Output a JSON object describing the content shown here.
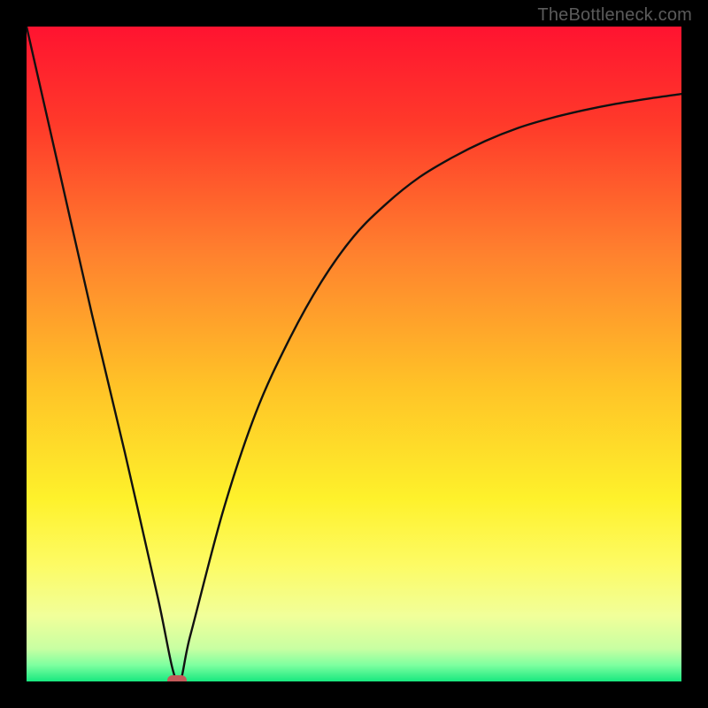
{
  "watermark": "TheBottleneck.com",
  "chart_data": {
    "type": "line",
    "title": "",
    "xlabel": "",
    "ylabel": "",
    "xlim": [
      0,
      100
    ],
    "ylim": [
      0,
      100
    ],
    "grid": false,
    "legend": false,
    "series": [
      {
        "name": "bottleneck-curve",
        "x": [
          0,
          5,
          10,
          15,
          20,
          23,
          25,
          30,
          35,
          40,
          45,
          50,
          55,
          60,
          65,
          70,
          75,
          80,
          85,
          90,
          95,
          100
        ],
        "y": [
          100,
          78,
          56,
          35,
          13,
          0,
          7,
          26,
          41,
          52,
          61,
          68,
          73,
          77,
          80,
          82.5,
          84.5,
          86,
          87.2,
          88.2,
          89,
          89.7
        ]
      }
    ],
    "annotations": [
      {
        "name": "minimum-marker",
        "x": 23,
        "y": 0
      }
    ],
    "background_gradient": {
      "stops": [
        {
          "pos": 0.0,
          "color": "#ff1330"
        },
        {
          "pos": 0.15,
          "color": "#ff3a2a"
        },
        {
          "pos": 0.35,
          "color": "#ff822e"
        },
        {
          "pos": 0.55,
          "color": "#ffc327"
        },
        {
          "pos": 0.72,
          "color": "#fef12b"
        },
        {
          "pos": 0.82,
          "color": "#fdfb63"
        },
        {
          "pos": 0.9,
          "color": "#f1ff9a"
        },
        {
          "pos": 0.95,
          "color": "#c8ffa2"
        },
        {
          "pos": 0.975,
          "color": "#7effa0"
        },
        {
          "pos": 1.0,
          "color": "#18e87f"
        }
      ]
    }
  }
}
